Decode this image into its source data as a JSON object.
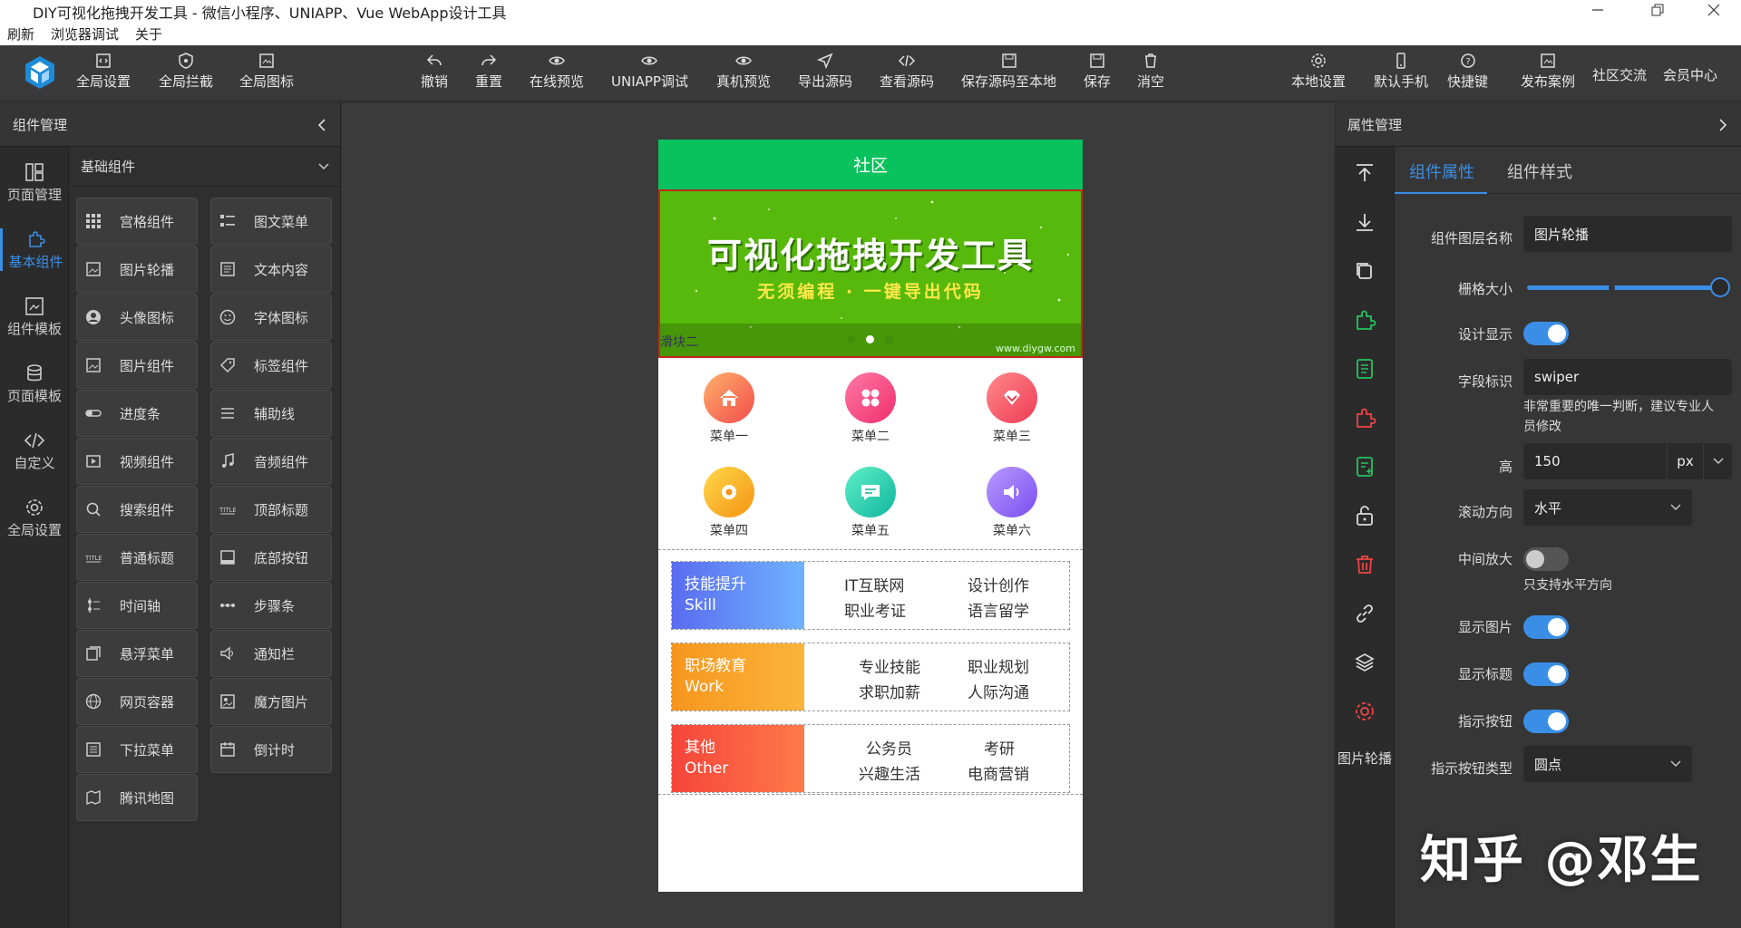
{
  "window": {
    "title": "DIY可视化拖拽开发工具 - 微信小程序、UNIAPP、Vue WebApp设计工具",
    "minimize": "—",
    "maximize": "❐",
    "close": "✕"
  },
  "menubar": [
    "刷新",
    "浏览器调试",
    "关于"
  ],
  "toolbar": {
    "left": [
      "全局设置",
      "全局拦截",
      "全局图标"
    ],
    "center": [
      "撤销",
      "重置",
      "在线预览",
      "UNIAPP调试",
      "真机预览",
      "导出源码",
      "查看源码",
      "保存源码至本地",
      "保存",
      "消空"
    ],
    "right": [
      "本地设置",
      "默认手机",
      "快捷键",
      "发布案例",
      "社区交流",
      "会员中心"
    ]
  },
  "leftpanel": {
    "title": "组件管理",
    "nav": [
      "页面管理",
      "基本组件",
      "组件模板",
      "页面模板",
      "自定义",
      "全局设置"
    ],
    "category": "基础组件",
    "components": [
      "宫格组件",
      "图文菜单",
      "图片轮播",
      "文本内容",
      "头像图标",
      "字体图标",
      "图片组件",
      "标签组件",
      "进度条",
      "辅助线",
      "视频组件",
      "音频组件",
      "搜索组件",
      "顶部标题",
      "普通标题",
      "底部按钮",
      "时间轴",
      "步骤条",
      "悬浮菜单",
      "通知栏",
      "网页容器",
      "魔方图片",
      "下拉菜单",
      "倒计时",
      "腾讯地图"
    ]
  },
  "phone": {
    "header": "社区",
    "banner": {
      "title": "可视化拖拽开发工具",
      "subtitle": "无须编程 · 一键导出代码",
      "caption": "滑块二",
      "watermark": "www.diygw.com",
      "active_dot": 1
    },
    "menus": [
      {
        "label": "菜单一",
        "color": "#f55a5a"
      },
      {
        "label": "菜单二",
        "color": "#f03a7a"
      },
      {
        "label": "菜单三",
        "color": "#f24f6a"
      },
      {
        "label": "菜单四",
        "color": "#f7a11a"
      },
      {
        "label": "菜单五",
        "color": "#19c7a6"
      },
      {
        "label": "菜单六",
        "color": "#8a5ef0"
      }
    ],
    "courses": [
      {
        "tag": "技能提升",
        "tag_en": "Skill",
        "kw": [
          "IT互联网",
          "设计创作",
          "职业考证",
          "语言留学"
        ],
        "from": "#5a6cf0",
        "to": "#6fb2ff"
      },
      {
        "tag": "职场教育",
        "tag_en": "Work",
        "kw": [
          "专业技能",
          "职业规划",
          "求职加薪",
          "人际沟通"
        ],
        "from": "#f7961e",
        "to": "#fbb43a"
      },
      {
        "tag": "其他",
        "tag_en": "Other",
        "kw": [
          "公务员",
          "考研",
          "兴趣生活",
          "电商营销"
        ],
        "from": "#f5453a",
        "to": "#ff7a4a"
      }
    ]
  },
  "rightpanel": {
    "title": "属性管理",
    "tabs": [
      "组件属性",
      "组件样式"
    ],
    "tool_label": "图片轮播",
    "layer_name_label": "组件图层名称",
    "layer_name": "图片轮播",
    "grid_label": "栅格大小",
    "grid_value": 0.98,
    "design_show_label": "设计显示",
    "field_label": "字段标识",
    "field_value": "swiper",
    "field_hint": "非常重要的唯一判断，建议专业人员修改",
    "height_label": "高",
    "height_value": "150",
    "height_unit": "px",
    "scroll_label": "滚动方向",
    "scroll_value": "水平",
    "center_zoom_label": "中间放大",
    "center_zoom_hint": "只支持水平方向",
    "show_image_label": "显示图片",
    "show_title_label": "显示标题",
    "indicator_label": "指示按钮",
    "indicator_type_label": "指示按钮类型",
    "indicator_type": "圆点"
  },
  "watermark": "知乎 @邓生"
}
